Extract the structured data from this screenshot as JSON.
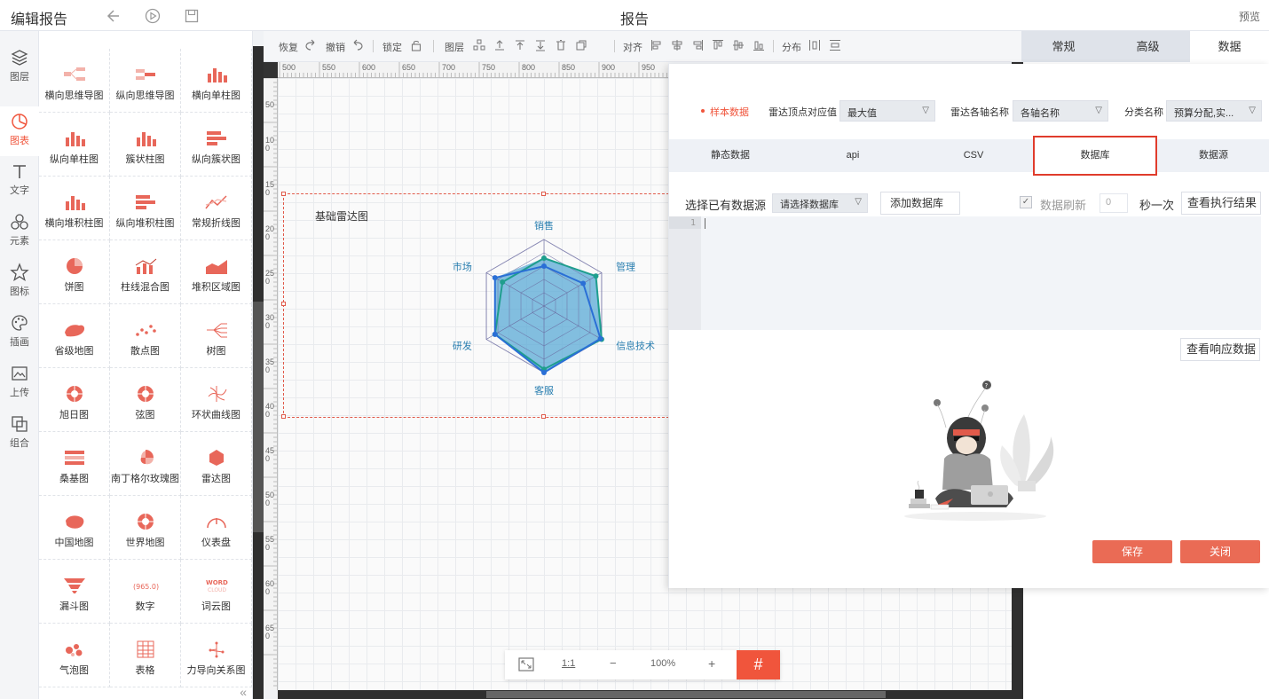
{
  "header": {
    "app_title": "编辑报告",
    "report_title": "报告",
    "preview": "预览"
  },
  "leftnav": [
    {
      "label": "图层",
      "icon": "layers-icon"
    },
    {
      "label": "图表",
      "icon": "chart-icon"
    },
    {
      "label": "文字",
      "icon": "text-icon"
    },
    {
      "label": "元素",
      "icon": "elements-icon"
    },
    {
      "label": "图标",
      "icon": "star-icon"
    },
    {
      "label": "插画",
      "icon": "palette-icon"
    },
    {
      "label": "上传",
      "icon": "upload-image-icon"
    },
    {
      "label": "组合",
      "icon": "group-icon"
    }
  ],
  "palette": [
    {
      "label": "横向思维导图"
    },
    {
      "label": "纵向思维导图"
    },
    {
      "label": "横向单柱图"
    },
    {
      "label": "纵向单柱图"
    },
    {
      "label": "簇状柱图"
    },
    {
      "label": "纵向簇状图"
    },
    {
      "label": "横向堆积柱图"
    },
    {
      "label": "纵向堆积柱图"
    },
    {
      "label": "常规折线图"
    },
    {
      "label": "饼图"
    },
    {
      "label": "柱线混合图"
    },
    {
      "label": "堆积区域图"
    },
    {
      "label": "省级地图"
    },
    {
      "label": "散点图"
    },
    {
      "label": "树图"
    },
    {
      "label": "旭日图"
    },
    {
      "label": "弦图"
    },
    {
      "label": "环状曲线图"
    },
    {
      "label": "桑基图"
    },
    {
      "label": "南丁格尔玫瑰图"
    },
    {
      "label": "雷达图"
    },
    {
      "label": "中国地图"
    },
    {
      "label": "世界地图"
    },
    {
      "label": "仪表盘"
    },
    {
      "label": "漏斗图"
    },
    {
      "label": "数字"
    },
    {
      "label": "词云图"
    },
    {
      "label": "气泡图"
    },
    {
      "label": "表格"
    },
    {
      "label": "力导向关系图"
    }
  ],
  "palette_icon_text": {
    "number": "(965.0)",
    "word1": "WORD",
    "word2": "CLOUD"
  },
  "toolbar": {
    "redo": "恢复",
    "undo": "撤销",
    "lock": "锁定",
    "layer": "图层",
    "align": "对齐",
    "distribute": "分布"
  },
  "ruler": [
    "500",
    "550",
    "600",
    "650",
    "700",
    "750",
    "800",
    "850",
    "900",
    "950"
  ],
  "ruler_v": [
    "50",
    "100",
    "150",
    "200",
    "250",
    "300",
    "350",
    "400",
    "450",
    "500",
    "550",
    "600",
    "650"
  ],
  "widget": {
    "title": "基础雷达图",
    "axes": [
      "销售",
      "管理",
      "信息技术",
      "客服",
      "研发",
      "市场"
    ]
  },
  "chart_data": {
    "type": "radar",
    "title": "基础雷达图",
    "categories": [
      "销售",
      "管理",
      "信息技术",
      "客服",
      "研发",
      "市场"
    ],
    "series": [
      {
        "values": [
          0.72,
          0.9,
          1.0,
          0.95,
          0.85,
          0.72
        ],
        "color": "#1f9e8e"
      },
      {
        "values": [
          0.6,
          0.68,
          0.98,
          1.0,
          0.85,
          0.85
        ],
        "color": "#2a6fd6"
      }
    ],
    "max": 1.0,
    "colors": {
      "fill": "#5aa9d6",
      "grid": "#6a6aa0"
    }
  },
  "zoom": {
    "fit": "",
    "one_to_one": "1:1",
    "minus": "−",
    "level": "100%",
    "plus": "+",
    "grid": "#"
  },
  "cfg_tabs": [
    {
      "label": "常规",
      "active": false
    },
    {
      "label": "高级",
      "active": false
    },
    {
      "label": "数据",
      "active": true
    }
  ],
  "dialog": {
    "sample": "样本数据",
    "vertex_label": "雷达顶点对应值",
    "vertex_value": "最大值",
    "axis_label": "雷达各轴名称",
    "axis_value": "各轴名称",
    "cat_label": "分类名称",
    "cat_value": "预算分配,实...",
    "src_tabs": [
      "静态数据",
      "api",
      "CSV",
      "数据库",
      "数据源"
    ],
    "choose_src": "选择已有数据源",
    "choose_db_placeholder": "请选择数据库",
    "add_db": "添加数据库",
    "refresh": "数据刷新",
    "refresh_num": "0",
    "per_sec": "秒一次",
    "view_exec": "查看执行结果",
    "line1": "1",
    "view_resp": "查看响应数据",
    "save": "保存",
    "close": "关闭"
  },
  "colors": {
    "accent": "#f0553c",
    "save": "#ea6b55"
  }
}
